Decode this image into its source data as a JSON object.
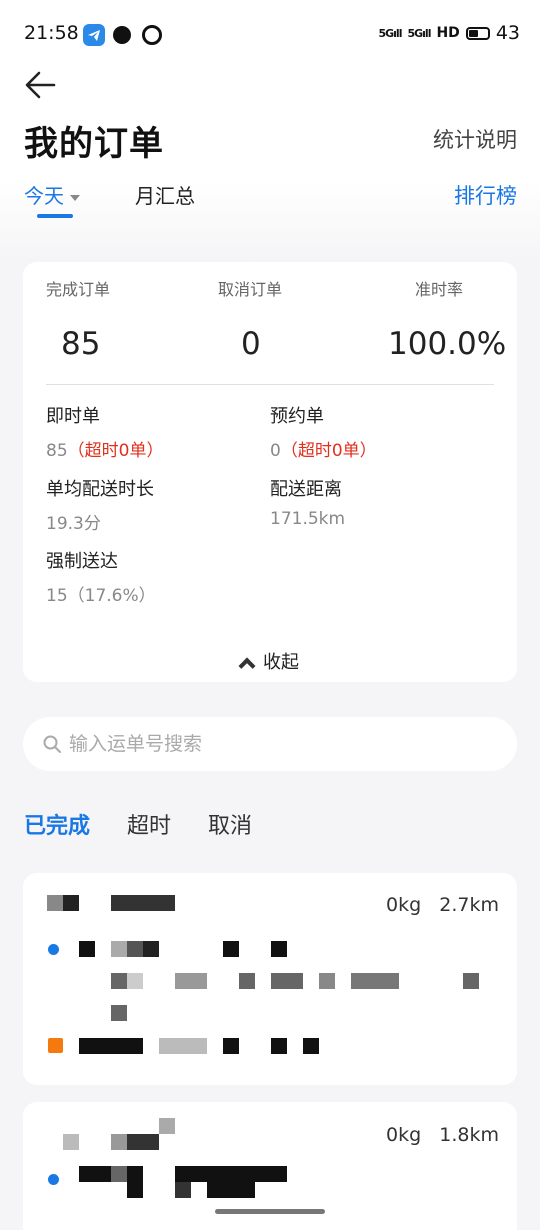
{
  "status_bar": {
    "time": "21:58",
    "signal_1": "5G",
    "signal_2": "5G",
    "network": "HD",
    "battery": "43",
    "icons": [
      "telegram-icon",
      "message-icon",
      "face-icon",
      "signal-icon",
      "battery-icon"
    ]
  },
  "header": {
    "title": "我的订单",
    "explain_link": "统计说明"
  },
  "tabs": {
    "today": "今天",
    "month": "月汇总",
    "ranking": "排行榜"
  },
  "summary": {
    "completed_label": "完成订单",
    "completed_value": "85",
    "cancelled_label": "取消订单",
    "cancelled_value": "0",
    "ontime_label": "准时率",
    "ontime_value": "100.0%",
    "instant_label": "即时单",
    "instant_value": "85",
    "instant_overtime": "（超时0单）",
    "reserved_label": "预约单",
    "reserved_value": "0",
    "reserved_overtime": "（超时0单）",
    "avg_time_label": "单均配送时长",
    "avg_time_value": "19.3分",
    "distance_label": "配送距离",
    "distance_value": "171.5km",
    "forced_label": "强制送达",
    "forced_value": "15（17.6%）",
    "collapse_label": "收起"
  },
  "search": {
    "placeholder": "输入运单号搜索"
  },
  "filter_tabs": {
    "completed": "已完成",
    "overtime": "超时",
    "cancelled": "取消"
  },
  "orders": [
    {
      "weight": "0kg",
      "distance": "2.7km"
    },
    {
      "weight": "0kg",
      "distance": "1.8km"
    }
  ],
  "colors": {
    "accent": "#1a78e5",
    "warning": "#e2301e",
    "pickup_marker": "#1a78e5",
    "dropoff_marker": "#f47a10"
  }
}
